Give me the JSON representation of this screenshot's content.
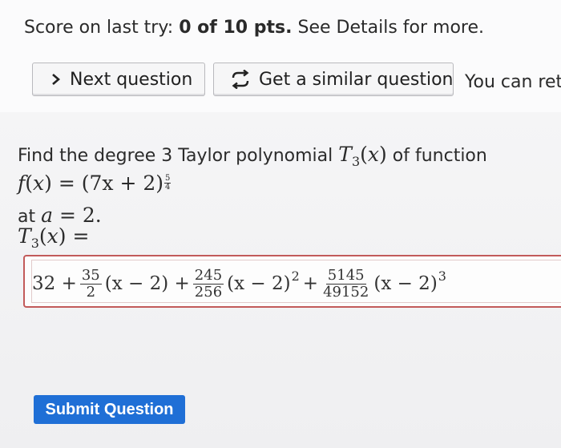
{
  "score": {
    "prefix": "Score on last try:",
    "value": "0 of 10 pts.",
    "suffix": "See Details for more."
  },
  "buttons": {
    "next_question": "Next question",
    "similar_question": "Get a similar question",
    "retry_text": "You can retr"
  },
  "question": {
    "intro": "Find the degree 3 Taylor polynomial",
    "intro_tail": "of function",
    "T_symbol": "T",
    "T_sub": "3",
    "var": "x",
    "f_name": "f",
    "f_rhs_base": "(7x + 2)",
    "f_exp_num": "5",
    "f_exp_den": "4",
    "at_word": "at",
    "a_sym": "a",
    "a_val": "= 2.",
    "T_eq": "="
  },
  "answer": {
    "const": "32 +",
    "term1_num": "35",
    "term1_den": "2",
    "term1_factor": "(x − 2) +",
    "term2_num": "245",
    "term2_den": "256",
    "term2_factor": "(x − 2)",
    "term2_exp": "2",
    "plus": "+",
    "term3_num": "5145",
    "term3_den": "49152",
    "term3_factor": "(x − 2)",
    "term3_exp": "3"
  },
  "submit": {
    "label": "Submit Question"
  },
  "colors": {
    "submit_bg": "#1f6fd6",
    "answer_border": "#c25a5a"
  }
}
